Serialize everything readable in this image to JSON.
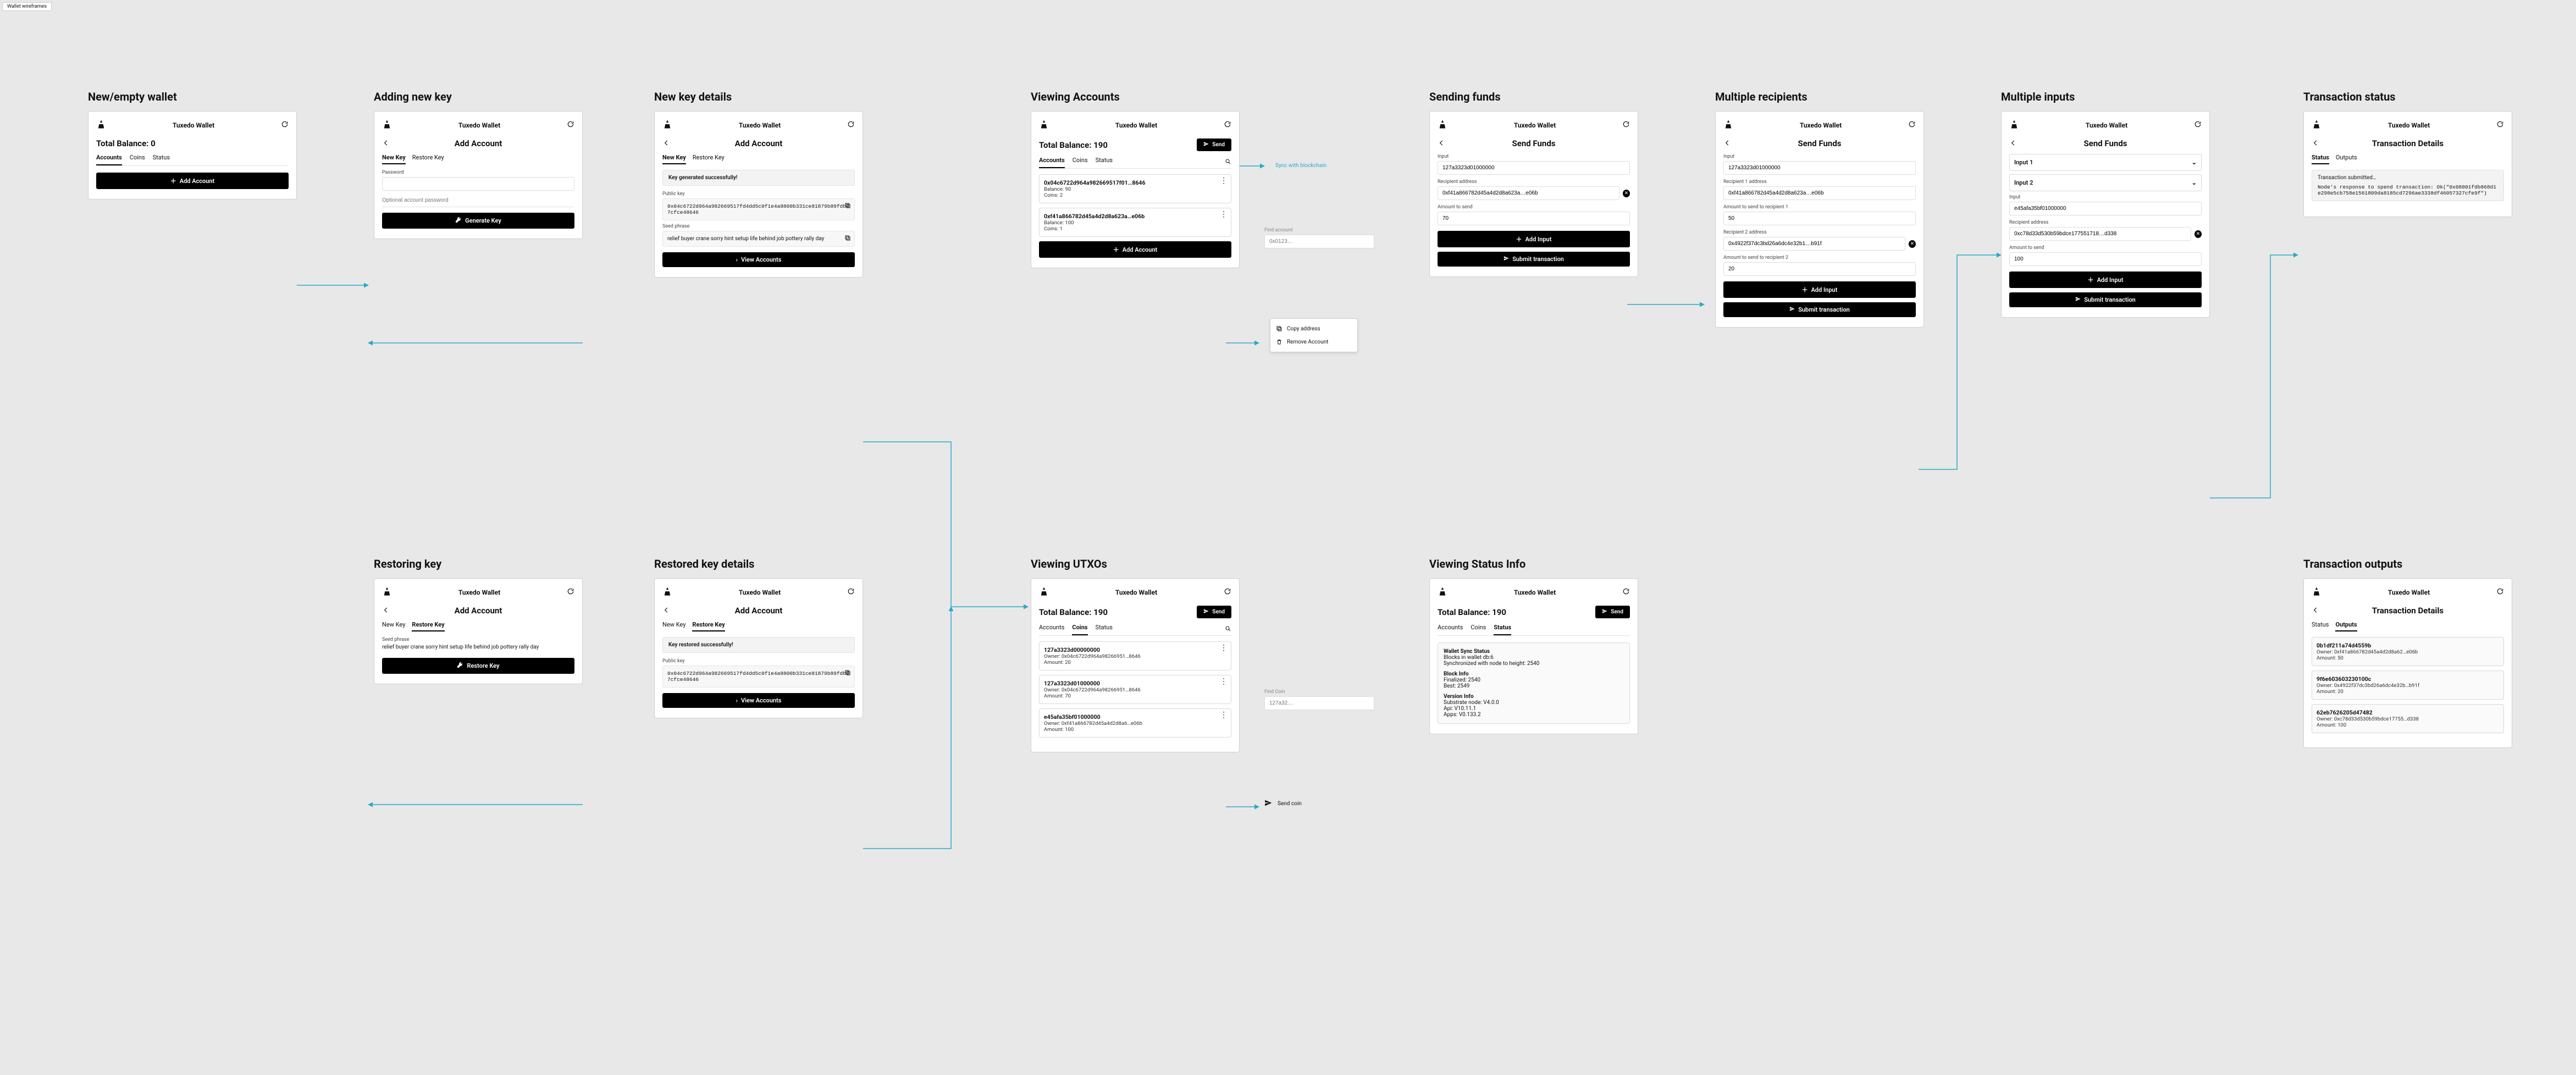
{
  "page_tab": "Wallet wireframes",
  "app_title": "Tuxedo Wallet",
  "sections": {
    "new_empty": "New/empty wallet",
    "adding_key": "Adding new key",
    "new_key_details": "New key details",
    "viewing_accounts": "Viewing Accounts",
    "sending_funds": "Sending funds",
    "multi_recip": "Multiple recipients",
    "multi_inputs": "Multiple inputs",
    "tx_status": "Transaction status",
    "restoring_key": "Restoring key",
    "restored_details": "Restored key details",
    "viewing_utxos": "Viewing UTXOs",
    "viewing_status": "Viewing Status Info",
    "tx_outputs": "Transaction outputs"
  },
  "common": {
    "add_account_title": "Add Account",
    "send_funds_title": "Send Funds",
    "tx_details_title": "Transaction Details",
    "tabs": {
      "accounts": "Accounts",
      "coins": "Coins",
      "status": "Status"
    },
    "sub_tabs": {
      "new_key": "New Key",
      "restore_key": "Restore Key"
    },
    "tx_tabs": {
      "status": "Status",
      "outputs": "Outputs"
    },
    "btn_add_account": "Add Account",
    "btn_generate_key": "Generate Key",
    "btn_view_accounts": "View Accounts",
    "btn_restore_key": "Restore Key",
    "btn_send": "Send",
    "btn_add_input": "Add Input",
    "btn_submit_tx": "Submit transaction",
    "copy_address": "Copy address",
    "remove_account": "Remove Account",
    "sync_label": "Sync with blockchain",
    "find_account": "Find account",
    "find_coin": "Find Coin",
    "send_coin": "Send coin",
    "search_placeholder_acc": "0x0123…",
    "search_placeholder_coin": "127a32…"
  },
  "balances": {
    "zero": "Total Balance: 0",
    "val": "Total Balance: 190"
  },
  "adding_key_frame": {
    "password_label": "Password",
    "password_placeholder": "Optional account password"
  },
  "new_key_frame": {
    "alert": "Key generated successfully!",
    "pubkey_label": "Public key",
    "pubkey": "0x04c6722d964a982669517fd4dd5c0f1e4a8800b331ce81879b89fdb17cfce48646",
    "seed_label": "Seed phrase",
    "seed": "relief buyer crane sorry hint setup life behind job pottery rally day"
  },
  "restoring_frame": {
    "seed_label": "Seed phrase",
    "seed": "relief buyer crane sorry hint setup life behind job pottery rally day"
  },
  "restored_frame": {
    "alert": "Key restored successfully!",
    "pubkey_label": "Public key",
    "pubkey": "0x04c6722d964a982669517fd4dd5c0f1e4a8800b331ce81879b89fdb17cfce48646"
  },
  "accounts": [
    {
      "addr": "0x04c6722d964a982669517f01…8646",
      "balance": "Balance: 90",
      "coins": "Coins: 2"
    },
    {
      "addr": "0xf41a866782d45a4d2d8a623a…e06b",
      "balance": "Balance: 100",
      "coins": "Coins: 1"
    }
  ],
  "utxos": [
    {
      "id": "127a3323d00000000",
      "owner": "Owner: 0x04c6722d964a98266951…8646",
      "amount": "Amount: 20"
    },
    {
      "id": "127a3323d01000000",
      "owner": "Owner: 0x04c6722d964a98266951…8646",
      "amount": "Amount: 70"
    },
    {
      "id": "e45afa35bf01000000",
      "owner": "Owner: 0xf41a866782d45a4d2d8a6…e06b",
      "amount": "Amount: 100"
    }
  ],
  "status_info": {
    "sync_h": "Wallet Sync Status",
    "sync_1": "Blocks in wallet db:6",
    "sync_2": "Synchronized with node to height: 2540",
    "block_h": "Block Info",
    "block_1": "Finalized: 2540",
    "block_2": "Best: 2549",
    "ver_h": "Version Info",
    "ver_1": "Substrate node: V4.0.0",
    "ver_2": "Api: V10.11.1",
    "ver_3": "Apps: V0.133.2"
  },
  "send_single": {
    "input_label": "Input",
    "input_val": "127a3323d01000000",
    "recip_label": "Recipient address",
    "recip_val": "0xf41a866782d45a4d2d8a623a…e06b",
    "amount_label": "Amount to send",
    "amount_val": "70"
  },
  "send_multi_recip": {
    "input_label": "Input",
    "input_val": "127a3323d01000000",
    "r1_label": "Recipient 1 address",
    "r1_val": "0xf41a866782d45a4d2d8a623a…e06b",
    "a1_label": "Amount to send to recipient 1",
    "a1_val": "50",
    "r2_label": "Recipient 2 address",
    "r2_val": "0x4922f37dc3bd26a6dc4e32b1…b91f",
    "a2_label": "Amount to send to recipient 2",
    "a2_val": "20"
  },
  "send_multi_input": {
    "input1": "Input 1",
    "input2": "Input 2",
    "in2_label": "Input",
    "in2_val": "e45afa35bf01000000",
    "recip_label": "Recipient address",
    "recip_val": "0xc78d33d530b59bdce177551718…d338",
    "amount_label": "Amount to send",
    "amount_val": "100"
  },
  "tx_status_frame": {
    "line1": "Transaction submitted…",
    "line2": "Node's response to spend transaction: Ok(\"0x08001fdb868d1e298e5cb758e1561809da8185cd7296ae3338df46057327cfe9f\")"
  },
  "tx_outputs_list": [
    {
      "id": "0b1df211a74d4559b",
      "owner": "Owner: 0xf41a866782d45a4d2d8a62…e06b",
      "amount": "Amount: 50"
    },
    {
      "id": "9f6e603603230100c",
      "owner": "Owner: 0x4922f37dc3bd26a6dc4e32b…b91f",
      "amount": "Amount: 20"
    },
    {
      "id": "62eb7626205d47482",
      "owner": "Owner: 0xc78d33d530b59bdce17755…d338",
      "amount": "Amount: 100"
    }
  ]
}
